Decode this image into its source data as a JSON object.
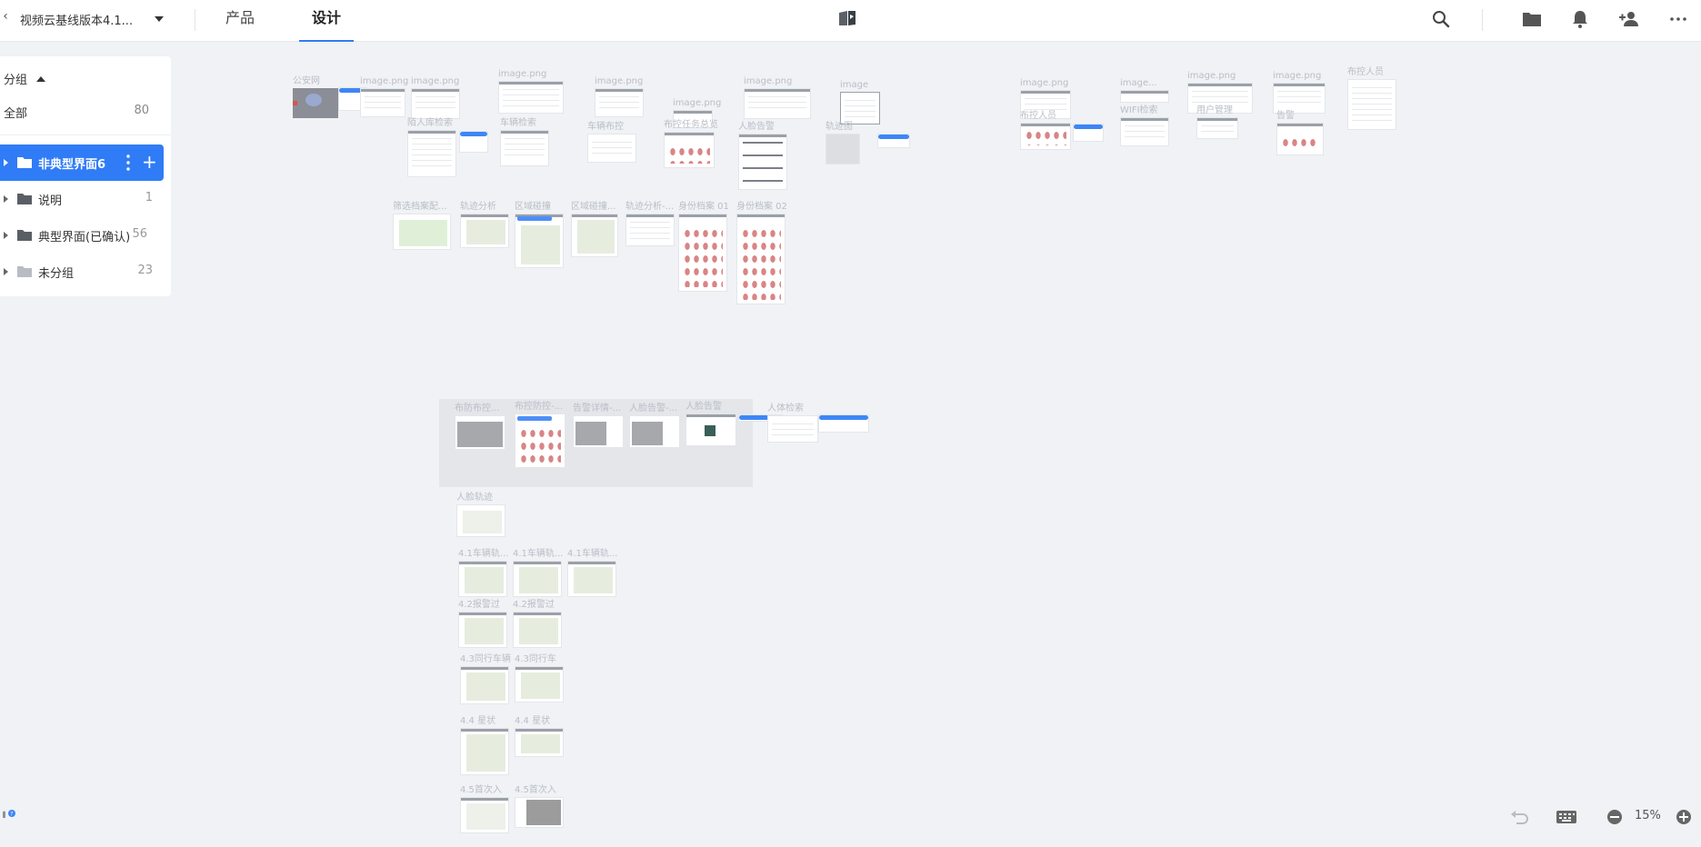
{
  "topbar": {
    "back_glyph": "‹",
    "project_title": "视频云基线版本4.1...",
    "tabs": [
      "产品",
      "设计"
    ],
    "active_tab": "设计",
    "accent": "#2f7cf6",
    "icons": [
      "search-icon",
      "folder-icon",
      "bell-icon",
      "add-user-icon",
      "more-icon"
    ]
  },
  "sidebar": {
    "heading": "分组",
    "all_label": "全部",
    "all_count": "80",
    "groups": [
      {
        "name": "非典型界面6",
        "count": "",
        "active": true
      },
      {
        "name": "说明",
        "count": "1",
        "active": false
      },
      {
        "name": "典型界面(已确认)",
        "count": "56",
        "active": false
      },
      {
        "name": "未分组",
        "count": "23",
        "active": false
      }
    ],
    "plus_glyph": "+"
  },
  "canvas": {
    "boards": [
      {
        "label": "公安网"
      },
      {
        "label": "image.png"
      },
      {
        "label": "image.png"
      },
      {
        "label": "image.png"
      },
      {
        "label": "image.png"
      },
      {
        "label": "image.png"
      },
      {
        "label": "image.png"
      },
      {
        "label": "image"
      },
      {
        "label": "image.png"
      },
      {
        "label": "image..."
      },
      {
        "label": "image.png"
      },
      {
        "label": "image.png"
      },
      {
        "label": "布控人员"
      },
      {
        "label": "陌人库检索"
      },
      {
        "label": "车辆检索"
      },
      {
        "label": "车辆布控"
      },
      {
        "label": "布控任务总览"
      },
      {
        "label": "人脸告警"
      },
      {
        "label": "轨迹图"
      },
      {
        "label": "布控人员"
      },
      {
        "label": "WIFI检索"
      },
      {
        "label": "用户管理"
      },
      {
        "label": "告警"
      },
      {
        "label": "筛选档案配..."
      },
      {
        "label": "轨迹分析"
      },
      {
        "label": "区域碰撞"
      },
      {
        "label": "区域碰撞..."
      },
      {
        "label": "轨迹分析-..."
      },
      {
        "label": "身份档案 01"
      },
      {
        "label": "身份档案 02"
      },
      {
        "label": "布防布控..."
      },
      {
        "label": "布控防控-..."
      },
      {
        "label": "告警详情-..."
      },
      {
        "label": "人脸告警-..."
      },
      {
        "label": "人脸告警"
      },
      {
        "label": "人体检索"
      },
      {
        "label": "人脸轨迹"
      },
      {
        "label": "4.1车辆轨..."
      },
      {
        "label": "4.1车辆轨..."
      },
      {
        "label": "4.1车辆轨..."
      },
      {
        "label": "4.2报警过"
      },
      {
        "label": "4.2报警过"
      },
      {
        "label": "4.3同行车辆"
      },
      {
        "label": "4.3同行车"
      },
      {
        "label": "4.4 星状"
      },
      {
        "label": "4.4 星状"
      },
      {
        "label": "4.5首次入"
      },
      {
        "label": "4.5首次入"
      }
    ]
  },
  "footer": {
    "zoom": "15%",
    "icons": [
      "help-icon",
      "undo-icon",
      "keyboard-icon",
      "zoom-out-icon",
      "zoom-in-icon"
    ]
  }
}
